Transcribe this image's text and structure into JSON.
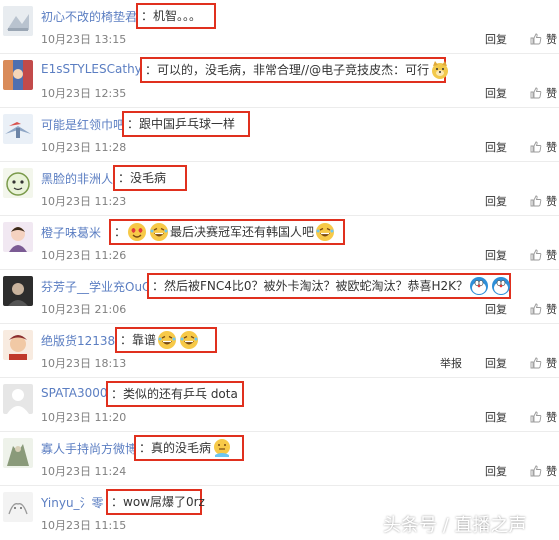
{
  "comments": [
    {
      "user": "初心不改的椅垫君",
      "text": "：机智。。。",
      "date": "10月23日 13:15",
      "reply": "回复",
      "like": "赞"
    },
    {
      "user": "E1sSTYLESCathy",
      "text": "：可以的，没毛病，非常合理//@电子竞技皮杰：可行",
      "date": "10月23日 12:35",
      "reply": "回复",
      "like": "赞"
    },
    {
      "user": "可能是红领巾吧",
      "text": "：跟中国乒乓球一样",
      "date": "10月23日 11:28",
      "reply": "回复",
      "like": "赞"
    },
    {
      "user": "黑脸的非洲人",
      "text": "：没毛病",
      "date": "10月23日 11:23",
      "reply": "回复",
      "like": "赞"
    },
    {
      "user": "橙子味葛米",
      "text_before": "：",
      "text": "最后决赛冠军还有韩国人吧",
      "date": "10月23日 11:26",
      "reply": "回复",
      "like": "赞"
    },
    {
      "user": "芬芳子__学业充OuO",
      "text": "：然后被FNC4比0？被外卡淘汰？被欧蛇淘汰？恭喜H2K？",
      "date": "10月23日 21:06",
      "reply": "回复",
      "like": "赞"
    },
    {
      "user": "绝版货12138",
      "text": "：靠谱",
      "date": "10月23日 18:13",
      "report": "举报",
      "reply": "回复",
      "like": "赞"
    },
    {
      "user": "SPATA3000",
      "text": "：类似的还有乒乓 dota",
      "date": "10月23日 11:20",
      "reply": "回复",
      "like": "赞"
    },
    {
      "user": "寡人手持尚方微博",
      "text": "：真的没毛病",
      "date": "10月23日 11:24",
      "reply": "回复",
      "like": "赞"
    },
    {
      "user": "Yinyu_氵零",
      "text": "：wow屌爆了0rz",
      "date": "10月23日 11:15",
      "reply": "回复",
      "like": "赞"
    }
  ],
  "watermark": "头条号 / 直播之声",
  "colors": {
    "username": "#5b7ec2",
    "highlight_border": "#e0301e",
    "date": "#808080"
  }
}
